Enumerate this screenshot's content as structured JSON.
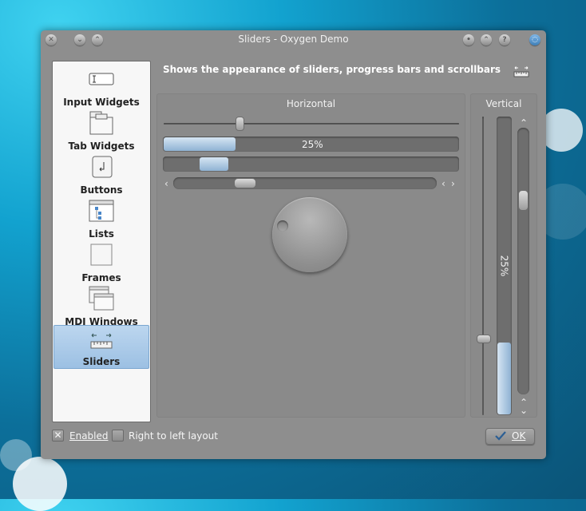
{
  "window": {
    "title": "Sliders - Oxygen Demo",
    "description": "Shows the appearance of sliders, progress bars and scrollbars"
  },
  "sidebar": {
    "items": [
      {
        "label": "Input Widgets",
        "icon": "input-widgets-icon"
      },
      {
        "label": "Tab Widgets",
        "icon": "tab-widgets-icon"
      },
      {
        "label": "Buttons",
        "icon": "buttons-icon"
      },
      {
        "label": "Lists",
        "icon": "lists-icon"
      },
      {
        "label": "Frames",
        "icon": "frames-icon"
      },
      {
        "label": "MDI Windows",
        "icon": "mdi-windows-icon"
      },
      {
        "label": "Sliders",
        "icon": "sliders-icon",
        "selected": true
      }
    ]
  },
  "horizontal": {
    "title": "Horizontal",
    "progress_text": "25%",
    "progress_value": 0.25
  },
  "vertical": {
    "title": "Vertical",
    "progress_text": "25%",
    "progress_value": 0.25
  },
  "footer": {
    "enabled_label": "Enabled",
    "enabled_checked": true,
    "rtl_label": "Right to left layout",
    "rtl_checked": false,
    "ok_label": "OK"
  },
  "colors": {
    "accent": "#9cc0e3",
    "window": "#8e8e8e"
  }
}
